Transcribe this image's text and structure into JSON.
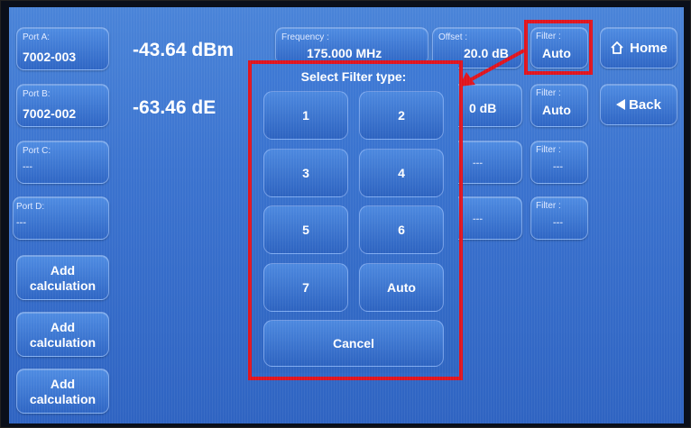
{
  "ports": [
    {
      "label": "Port A:",
      "value": "7002-003",
      "reading": "-43.64 dBm"
    },
    {
      "label": "Port B:",
      "value": "7002-002",
      "reading": "-63.46 dE"
    },
    {
      "label": "Port C:",
      "value": "---"
    },
    {
      "label": "Port D:",
      "value": "---"
    }
  ],
  "add_calc": [
    "Add calculation",
    "Add calculation",
    "Add calculation"
  ],
  "frequency": {
    "label": "Frequency :",
    "value": "175.000 MHz"
  },
  "offset_a": {
    "label": "Offset :",
    "value": "20.0 dB"
  },
  "offset_b": {
    "value": "0 dB"
  },
  "offset_c": {
    "value": "---"
  },
  "offset_d": {
    "value": "---"
  },
  "filter_a": {
    "label": "Filter :",
    "value": "Auto"
  },
  "filter_b": {
    "label": "Filter :",
    "value": "Auto"
  },
  "filter_c": {
    "label": "Filter :",
    "value": "---"
  },
  "filter_d": {
    "label": "Filter :",
    "value": "---"
  },
  "nav": {
    "home": "Home",
    "back": "Back"
  },
  "dialog": {
    "title": "Select Filter type:",
    "options": [
      "1",
      "2",
      "3",
      "4",
      "5",
      "6",
      "7",
      "Auto"
    ],
    "cancel": "Cancel"
  },
  "colors": {
    "highlight": "#e0141e",
    "screen": "#3b73cf"
  }
}
